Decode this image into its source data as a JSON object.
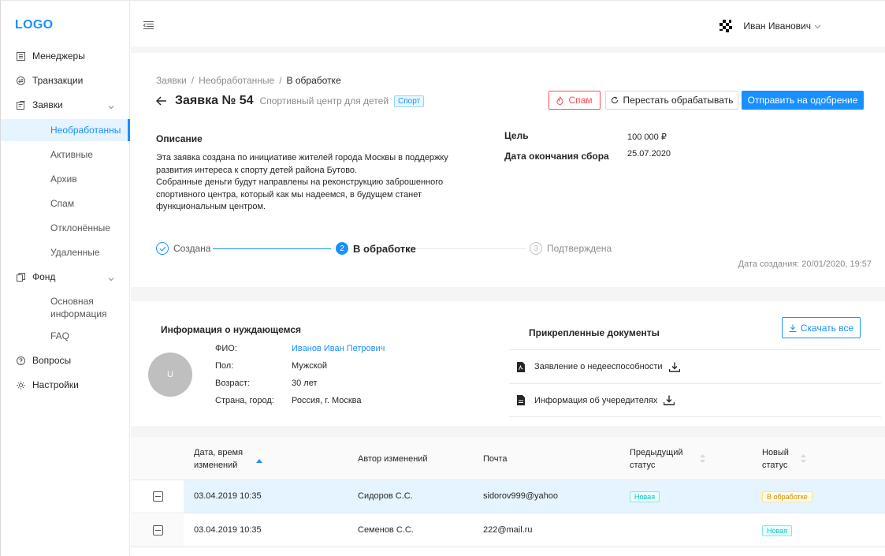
{
  "logo": "LOGO",
  "sidebar": {
    "items": [
      {
        "label": "Менеджеры",
        "icon": "list-icon"
      },
      {
        "label": "Транзакции",
        "icon": "exchange-icon"
      },
      {
        "label": "Заявки",
        "icon": "form-icon"
      },
      {
        "label": "Фонд",
        "icon": "copy-icon"
      },
      {
        "label": "Вопросы",
        "icon": "question-icon"
      },
      {
        "label": "Настройки",
        "icon": "gear-icon"
      }
    ],
    "requests_sub": [
      "Необработанны",
      "Активные",
      "Архив",
      "Спам",
      "Отклонённые",
      "Удаленные"
    ],
    "fund_sub": [
      "Основная информация",
      "FAQ"
    ]
  },
  "header": {
    "user_name": "Иван Иванович"
  },
  "breadcrumb": [
    "Заявки",
    "Необработанные",
    "В обработке"
  ],
  "title": "Заявка № 54",
  "subtitle": "Спортивный центр для детей",
  "tag": "Спорт",
  "buttons": {
    "spam": "Спам",
    "stop": "Перестать обрабатывать",
    "send": "Отправить на одобрение"
  },
  "description": {
    "title": "Описание",
    "text": "Эта заявка создана по инициативе жителей города Москвы в поддержку\nразвития интереса к спорту детей района Бутово.\nСобранные деньги будут направлены на реконструкцию заброшенного\nспортивного центра, который как мы надеемся, в будущем станет\nфункциональным центром."
  },
  "goal": {
    "label": "Цель",
    "value": "100 000 ₽"
  },
  "deadline": {
    "label": "Дата окончания сбора",
    "value": "25.07.2020"
  },
  "steps": [
    {
      "num": "✓",
      "label": "Создана",
      "state": "done"
    },
    {
      "num": "2",
      "label": "В обработке",
      "state": "active"
    },
    {
      "num": "3",
      "label": "Подтверждена",
      "state": "wait"
    }
  ],
  "created_at": "Дата создания: 20/01/2020, 19:57",
  "person": {
    "title": "Информация о нуждающемся",
    "avatar_letter": "U",
    "fields": [
      {
        "label": "ФИО:",
        "value": "Иванов Иван Петрович"
      },
      {
        "label": "Пол:",
        "value": "Мужской"
      },
      {
        "label": "Возраст:",
        "value": "30 лет"
      },
      {
        "label": "Страна, город:",
        "value": "Россия, г. Москва"
      }
    ]
  },
  "docs": {
    "title": "Прикрепленные документы",
    "download_all": "Скачать все",
    "items": [
      {
        "name": "Заявление о недееспособности",
        "icon": "pdf-file-icon"
      },
      {
        "name": "Информация об учередителях",
        "icon": "file-icon"
      }
    ]
  },
  "table": {
    "columns": {
      "date": "Дата, время\nизменений",
      "author": "Автор изменений",
      "email": "Почта",
      "prev": "Предыдущий\nстатус",
      "new": "Новый\nстатус"
    },
    "rows": [
      {
        "date": "03.04.2019 10:35",
        "author": "Сидоров С.С.",
        "email": "sidorov999@yahoo",
        "prev": "Новая",
        "new": "В обработке"
      },
      {
        "date": "03.04.2019 10:35",
        "author": "Семенов С.С.",
        "email": "222@mail.ru",
        "prev": "",
        "new": "Новая"
      }
    ]
  },
  "colors": {
    "primary": "#1890ff",
    "danger": "#ff4d4f",
    "tag_new": "#13c2c2",
    "tag_processing": "#d48806"
  }
}
